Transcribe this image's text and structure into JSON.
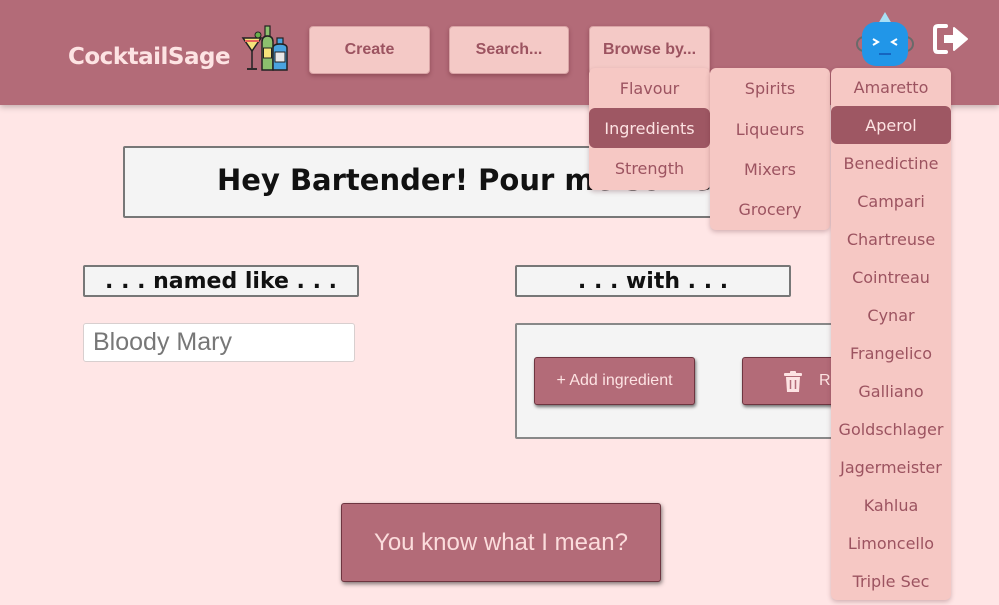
{
  "app": {
    "brand": "CocktailSage",
    "logo_icon": "cocktail-bottles-icon"
  },
  "nav": {
    "create_label": "Create",
    "search_label": "Search...",
    "browse_label": "Browse by...",
    "avatar_icon": "robot-avatar-icon",
    "logout_icon": "logout-icon"
  },
  "browse_menu": {
    "items": [
      "Flavour",
      "Ingredients",
      "Strength"
    ],
    "active": "Ingredients"
  },
  "ingredients_menu": {
    "items": [
      "Spirits",
      "Liqueurs",
      "Mixers",
      "Grocery"
    ]
  },
  "liqueurs_menu": {
    "items": [
      "Amaretto",
      "Aperol",
      "Benedictine",
      "Campari",
      "Chartreuse",
      "Cointreau",
      "Cynar",
      "Frangelico",
      "Galliano",
      "Goldschlager",
      "Jagermeister",
      "Kahlua",
      "Limoncello",
      "Triple Sec"
    ],
    "active": "Aperol"
  },
  "main": {
    "heading": "Hey Bartender! Pour me something...",
    "named_label": ". . . named like . . .",
    "with_label": ". . . with . . .",
    "name_placeholder": "Bloody Mary",
    "add_ingredient_label": "+ Add ingredient",
    "remove_label": "Remove",
    "trash_icon": "trash-icon",
    "submit_label": "You know what I mean?"
  },
  "colors": {
    "page_bg": "#ffe6e6",
    "navbar": "#b36b78",
    "button_light": "#f4c9c6",
    "accent_dark": "#9e5763",
    "text_rose": "#9c5360"
  }
}
